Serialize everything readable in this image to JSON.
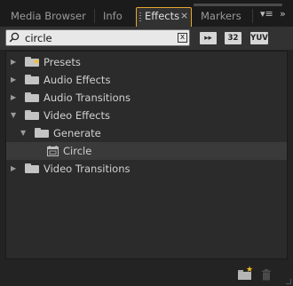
{
  "tabs": {
    "media_browser": "Media Browser",
    "info": "Info",
    "effects": "Effects",
    "effects_close": "×",
    "markers": "Markers",
    "menu_glyph": "▾≡",
    "more_glyph": "»"
  },
  "search": {
    "value": "circle",
    "clear_glyph": "x"
  },
  "toolbar": {
    "accelerated_label": "▸▸",
    "bit32_label": "32",
    "yuv_label": "YUV"
  },
  "tree": {
    "items": [
      {
        "label": "Presets",
        "level": 0,
        "expanded": false,
        "icon": "preset-folder-icon"
      },
      {
        "label": "Audio Effects",
        "level": 0,
        "expanded": false,
        "icon": "folder-icon"
      },
      {
        "label": "Audio Transitions",
        "level": 0,
        "expanded": false,
        "icon": "folder-icon"
      },
      {
        "label": "Video Effects",
        "level": 0,
        "expanded": true,
        "icon": "folder-icon"
      },
      {
        "label": "Generate",
        "level": 1,
        "expanded": true,
        "icon": "folder-icon"
      },
      {
        "label": "Circle",
        "level": 2,
        "selected": true,
        "icon": "effect-icon"
      },
      {
        "label": "Video Transitions",
        "level": 0,
        "expanded": false,
        "icon": "folder-icon"
      }
    ]
  },
  "colors": {
    "accent_tab_border": "#e8a530",
    "preset_star": "#f2c023"
  }
}
